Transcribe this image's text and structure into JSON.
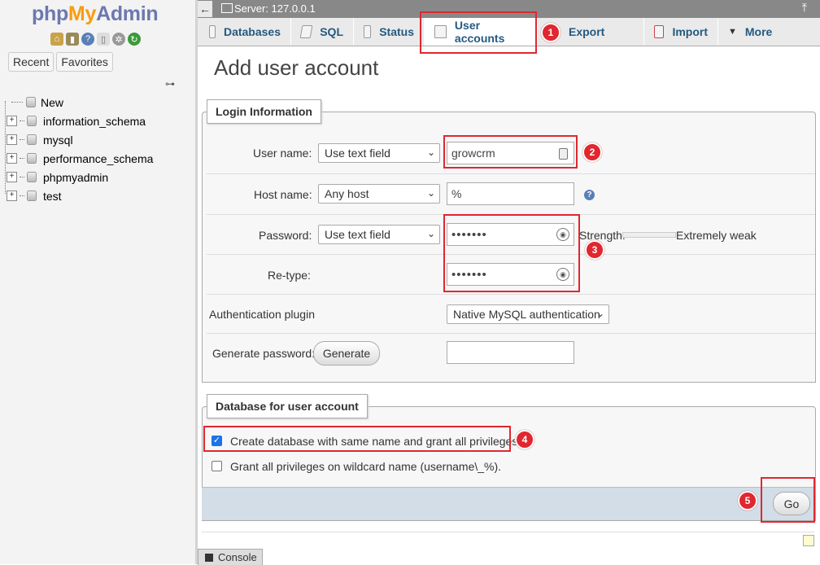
{
  "nav": {
    "logo": {
      "php": "php",
      "my": "My",
      "admin": "Admin"
    },
    "icons": [
      "home-icon",
      "logout-icon",
      "help-icon",
      "docs-icon",
      "settings-icon",
      "reload-icon"
    ],
    "tabs": [
      "Recent",
      "Favorites"
    ],
    "tree": [
      "New",
      "information_schema",
      "mysql",
      "performance_schema",
      "phpmyadmin",
      "test"
    ]
  },
  "serverbar": {
    "label": "Server: 127.0.0.1"
  },
  "tabs": [
    {
      "label": "Databases",
      "icon": "database-icon"
    },
    {
      "label": "SQL",
      "icon": "sql-icon"
    },
    {
      "label": "Status",
      "icon": "status-icon"
    },
    {
      "label": "User accounts",
      "icon": "users-icon",
      "active": true
    },
    {
      "label": "Export",
      "icon": "export-icon"
    },
    {
      "label": "Import",
      "icon": "import-icon"
    },
    {
      "label": "More",
      "icon": "chevron-down-icon"
    }
  ],
  "page_title": "Add user account",
  "login": {
    "legend": "Login Information",
    "user_name_label": "User name:",
    "user_name_select": "Use text field",
    "user_name_value": "growcrm",
    "host_name_label": "Host name:",
    "host_name_select": "Any host",
    "host_name_value": "%",
    "password_label": "Password:",
    "password_select": "Use text field",
    "password_value": "•••••••",
    "strength_label": "Strength:",
    "strength_value": "Extremely weak",
    "retype_label": "Re-type:",
    "retype_value": "•••••••",
    "auth_label": "Authentication plugin",
    "auth_value": "Native MySQL authentication",
    "genpw_label": "Generate password:",
    "generate_button": "Generate"
  },
  "database": {
    "legend": "Database for user account",
    "create_db_label": "Create database with same name and grant all privileges.",
    "create_db_checked": true,
    "wildcard_label": "Grant all privileges on wildcard name (username\\_%).",
    "wildcard_checked": false
  },
  "go_button": "Go",
  "console": "Console",
  "annotations": [
    "1",
    "2",
    "3",
    "4",
    "5"
  ],
  "colors": {
    "accent": "#235a81",
    "annotation_red": "#e0272f",
    "footer": "#d2dde7"
  }
}
